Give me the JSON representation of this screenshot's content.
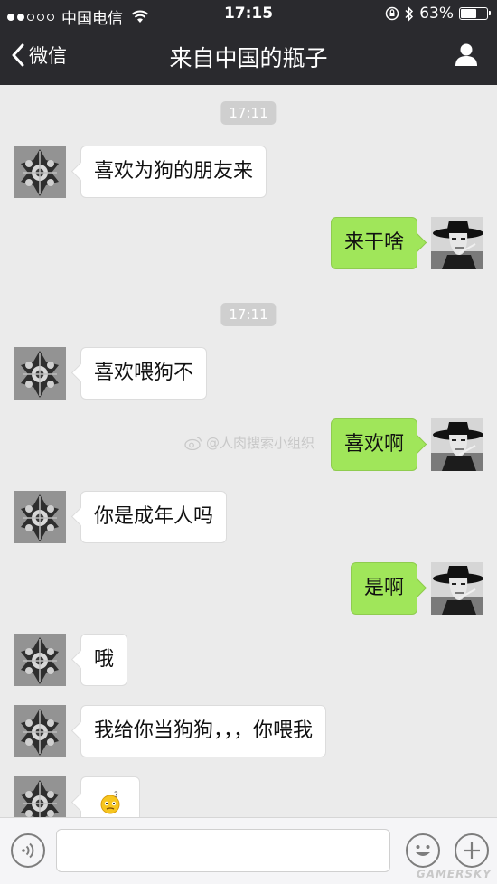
{
  "status_bar": {
    "carrier": "中国电信",
    "time": "17:15",
    "battery_percent": "63%",
    "battery_level": 0.63,
    "signal_bars_filled": 2,
    "signal_bars_total": 5
  },
  "nav": {
    "back_label": "微信",
    "title": "来自中国的瓶子"
  },
  "chat": {
    "timestamps": [
      "17:11",
      "17:11"
    ],
    "messages": [
      {
        "side": "left",
        "text": "喜欢为狗的朋友来"
      },
      {
        "side": "right",
        "text": "来干啥"
      },
      {
        "side": "left",
        "text": "喜欢喂狗不"
      },
      {
        "side": "right",
        "text": "喜欢啊"
      },
      {
        "side": "left",
        "text": "你是成年人吗"
      },
      {
        "side": "right",
        "text": "是啊"
      },
      {
        "side": "left",
        "text": "哦"
      },
      {
        "side": "left",
        "text": "我给你当狗狗，，，你喂我"
      },
      {
        "side": "left",
        "text": "",
        "emoji": "confused-emoji"
      }
    ],
    "watermark": "@人肉搜索小组织"
  },
  "input_bar": {
    "value": "",
    "icons": [
      "voice-icon",
      "smiley-icon",
      "plus-icon"
    ]
  },
  "corner_watermark": "GAMERSKY",
  "colors": {
    "bar_bg": "#2a2a2e",
    "chat_bg": "#ebebeb",
    "sent_bubble": "#a0e65a",
    "received_bubble": "#ffffff"
  }
}
